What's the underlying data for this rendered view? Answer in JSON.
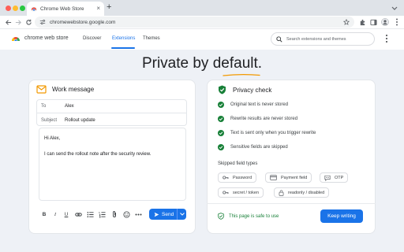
{
  "browser": {
    "tab_title": "Chrome Web Store",
    "tab_close": "×",
    "new_tab": "+",
    "url": "chromewebstore.google.com",
    "traffic_colors": [
      "#ff5f57",
      "#febc2e",
      "#28c840"
    ]
  },
  "store": {
    "name": "chrome web store",
    "nav": [
      "Discover",
      "Extensions",
      "Themes"
    ],
    "active_nav": "Extensions",
    "search_placeholder": "Search extensions and themes"
  },
  "hero": {
    "title_prefix": "Private by ",
    "title_emphasis": "default",
    "title_suffix": "."
  },
  "compose": {
    "title": "Work message",
    "to_label": "To",
    "to_value": "Alex",
    "subject_label": "Subject",
    "subject_value": "Rollout update",
    "body_greeting": "Hi Alex,",
    "body_line": "I can send the rollout note after the security review.",
    "toolbar": [
      "B",
      "I",
      "U",
      "link",
      "bulleted-list",
      "numbered-list",
      "attach",
      "emoji",
      "more"
    ],
    "send_label": "Send"
  },
  "privacy": {
    "title": "Privacy check",
    "checks": [
      "Original text is never stored",
      "Rewrite results are never stored",
      "Text is sent only when you trigger rewrite",
      "Sensitive fields are skipped"
    ],
    "skipped_title": "Skipped field types",
    "skipped": [
      {
        "label": "Password",
        "icon": "key-icon"
      },
      {
        "label": "Payment field",
        "icon": "card-icon"
      },
      {
        "label": "OTP",
        "icon": "chat-icon"
      },
      {
        "label": "secret / token",
        "icon": "key-icon"
      },
      {
        "label": "readonly / disabled",
        "icon": "lock-icon"
      }
    ],
    "safe_text": "This page is safe to use",
    "keep_button": "Keep writing"
  },
  "colors": {
    "accent": "#1a73e8",
    "success": "#188038",
    "mail_icon": "#f29900"
  }
}
